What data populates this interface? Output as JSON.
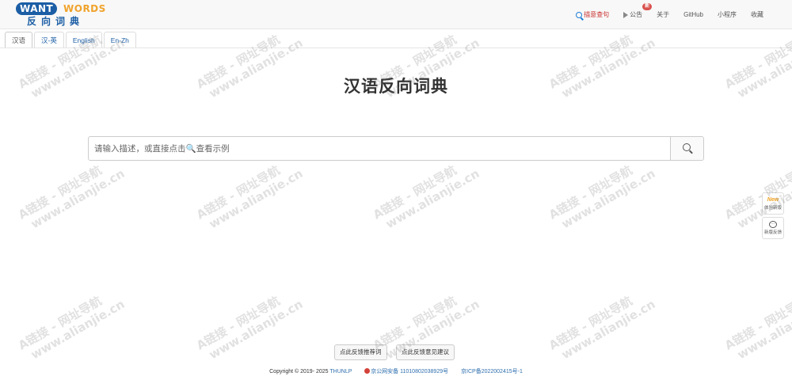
{
  "header": {
    "logo": {
      "want": "WANT",
      "words": "WORDS",
      "subtitle": "反向词典"
    },
    "nav": {
      "search_mode": "描意查句",
      "announcement": "公告",
      "announcement_badge": "新",
      "about": "关于",
      "github": "GitHub",
      "mini_program": "小程序",
      "favorites": "收藏"
    }
  },
  "tabs": [
    "汉语",
    "汉-英",
    "English",
    "En-Zh"
  ],
  "main": {
    "title": "汉语反向词典",
    "search": {
      "placeholder": "请输入描述，或直接点击🔍查看示例"
    }
  },
  "side": {
    "new_features": {
      "glyph": "New",
      "label": "体验新版"
    },
    "feedback": {
      "glyph": "···",
      "label": "新版反馈"
    }
  },
  "feedback_buttons": {
    "recommend": "点此反馈推荐词",
    "suggestion": "点此反馈意见建议"
  },
  "footer": {
    "copyright": "Copyright © 2019- 2025",
    "org": "THUNLP",
    "police": "京公网安备 11010802038929号",
    "icp": "京ICP备2022002415号-1"
  },
  "watermark": {
    "line1": "A链接 - 网址导航",
    "line2": "www.alianjie.cn"
  },
  "colors": {
    "brand_blue": "#1b5ea5",
    "brand_orange": "#f0a32c",
    "badge_red": "#d9534f",
    "link_blue": "#2f6fae"
  }
}
